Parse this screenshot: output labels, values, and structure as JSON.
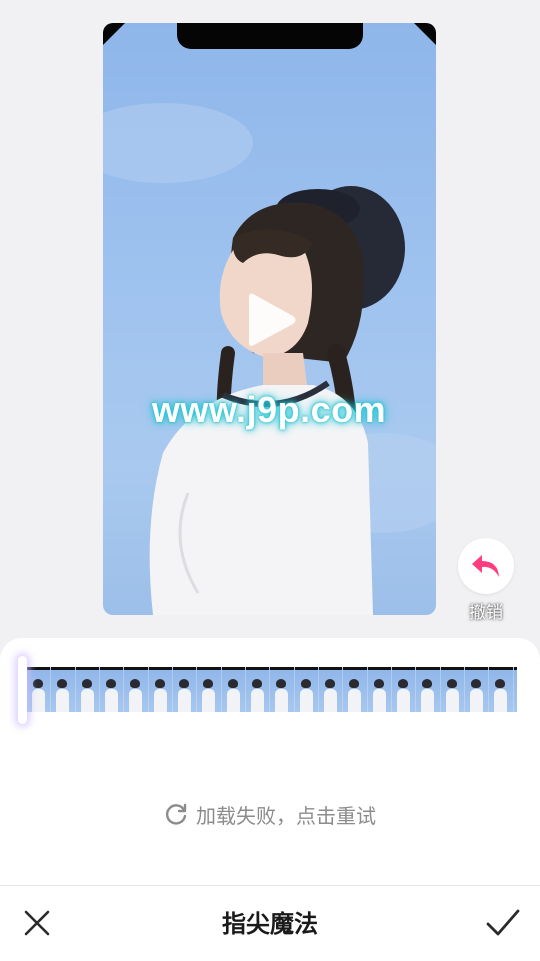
{
  "preview": {
    "watermark": "www.j9p.com"
  },
  "undo": {
    "label": "撤销"
  },
  "retry": {
    "text": "加载失败，点击重试"
  },
  "bottom_bar": {
    "title": "指尖魔法"
  },
  "colors": {
    "accent": "#ff3d7f",
    "background": "#f1f1f3",
    "text_muted": "#8c8c8c"
  },
  "icons": {
    "undo": "undo-arrow-icon",
    "retry": "refresh-icon",
    "close": "close-icon",
    "confirm": "checkmark-icon",
    "play": "play-icon"
  }
}
